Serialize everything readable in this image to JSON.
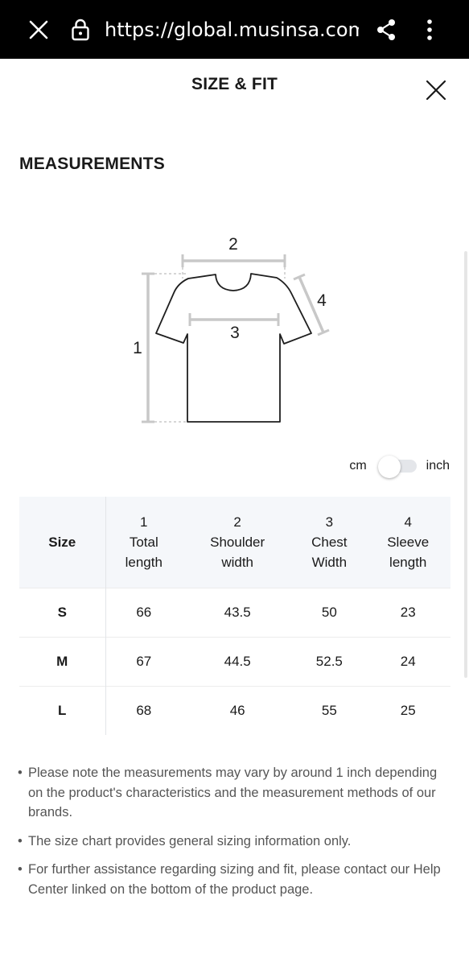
{
  "browser": {
    "url": "https://global.musinsa.com/h",
    "icons": [
      "close-icon",
      "lock-icon",
      "share-icon",
      "more-vertical-icon"
    ]
  },
  "sheet": {
    "title": "SIZE & FIT"
  },
  "measurements": {
    "title": "MEASUREMENTS",
    "diagram_labels": {
      "total_length": "1",
      "shoulder": "2",
      "chest": "3",
      "sleeve": "4"
    }
  },
  "unit_toggle": {
    "left": "cm",
    "right": "inch",
    "selected": "cm"
  },
  "table": {
    "size_header": "Size",
    "columns": [
      {
        "num": "1",
        "line1": "Total",
        "line2": "length"
      },
      {
        "num": "2",
        "line1": "Shoulder",
        "line2": "width"
      },
      {
        "num": "3",
        "line1": "Chest",
        "line2": "Width"
      },
      {
        "num": "4",
        "line1": "Sleeve",
        "line2": "length"
      }
    ],
    "rows": [
      {
        "size": "S",
        "values": [
          "66",
          "43.5",
          "50",
          "23"
        ]
      },
      {
        "size": "M",
        "values": [
          "67",
          "44.5",
          "52.5",
          "24"
        ]
      },
      {
        "size": "L",
        "values": [
          "68",
          "46",
          "55",
          "25"
        ]
      }
    ]
  },
  "notes": [
    "Please note the measurements may vary by around 1 inch depending on the product's characteristics and the measurement methods of our brands.",
    "The size chart provides general sizing information only.",
    "For further assistance regarding sizing and fit, please contact our Help Center linked on the bottom of the product page."
  ],
  "colors": {
    "browser_bar": "#000000",
    "table_header_bg": "#f5f7fa",
    "dimension_lines": "#c8c8c8"
  }
}
